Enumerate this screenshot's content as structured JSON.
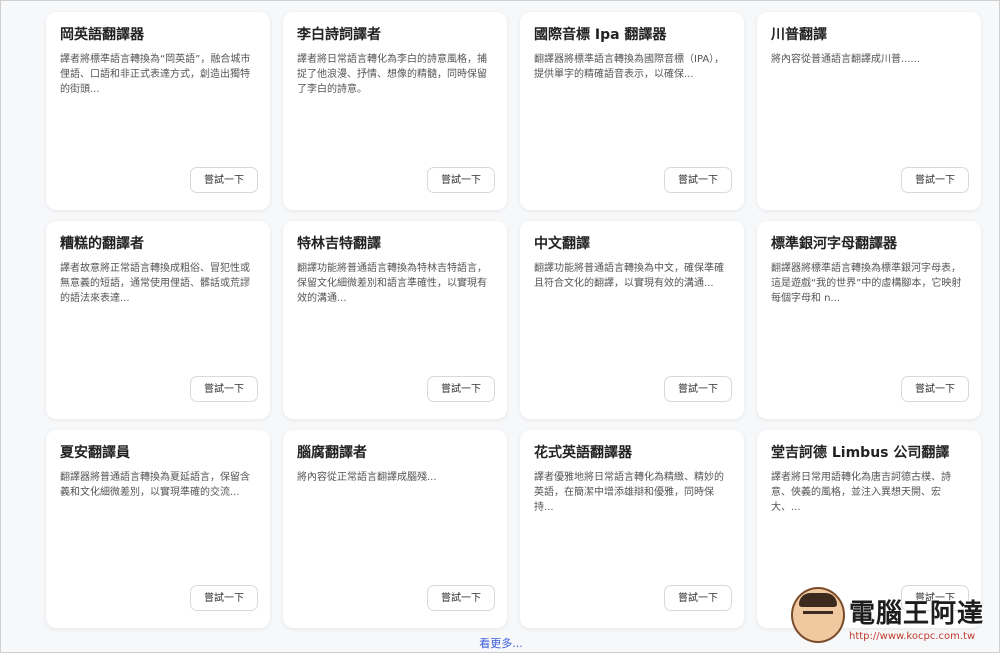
{
  "cards": [
    {
      "title": "岡英語翻譯器",
      "desc": "譯者將標準語言轉換為“岡英語”，融合城市俚語、口語和非正式表達方式，創造出獨特的街頭...",
      "button": "嘗試一下"
    },
    {
      "title": "李白詩詞譯者",
      "desc": "譯者將日常語言轉化為李白的詩意風格，捕捉了他浪漫、抒情、想像的精髓，同時保留了李白的詩意。",
      "button": "嘗試一下"
    },
    {
      "title": "國際音標 Ipa 翻譯器",
      "desc": "翻譯器將標準語言轉換為國際音標（IPA），提供單字的精確語音表示，以確保...",
      "button": "嘗試一下"
    },
    {
      "title": "川普翻譯",
      "desc": "將內容從普通語言翻譯成川普......",
      "button": "嘗試一下"
    },
    {
      "title": "糟糕的翻譯者",
      "desc": "譯者故意將正常語言轉換成粗俗、冒犯性或無意義的短語，通常使用俚語、髒話或荒謬的語法來表達...",
      "button": "嘗試一下"
    },
    {
      "title": "特林吉特翻譯",
      "desc": "翻譯功能將普通語言轉換為特林吉特語言，保留文化細微差別和語言準確性，以實現有效的溝通...",
      "button": "嘗試一下"
    },
    {
      "title": "中文翻譯",
      "desc": "翻譯功能將普通語言轉換為中文，確保準確且符合文化的翻譯，以實現有效的溝通...",
      "button": "嘗試一下"
    },
    {
      "title": "標準銀河字母翻譯器",
      "desc": "翻譯器將標準語言轉換為標準銀河字母表，這是遊戲“我的世界”中的虛構腳本，它映射每個字母和 n...",
      "button": "嘗試一下"
    },
    {
      "title": "夏安翻譯員",
      "desc": "翻譯器將普通語言轉換為夏延語言，保留含義和文化細微差別，以實現準確的交流...",
      "button": "嘗試一下"
    },
    {
      "title": "腦腐翻譯者",
      "desc": "將內容從正常語言翻譯成腦殘...",
      "button": "嘗試一下"
    },
    {
      "title": "花式英語翻譯器",
      "desc": "譯者優雅地將日常語言轉化為精緻、精妙的英語，在簡潔中增添雄辯和優雅，同時保持...",
      "button": "嘗試一下"
    },
    {
      "title": "堂吉訶德 Limbus 公司翻譯",
      "desc": "譯者將日常用語轉化為唐吉訶德古樸、詩意、俠義的風格，並注入異想天開、宏大、...",
      "button": "嘗試一下"
    }
  ],
  "see_more": "看更多...",
  "watermark": {
    "text": "電腦王阿達",
    "url": "http://www.kocpc.com.tw"
  }
}
